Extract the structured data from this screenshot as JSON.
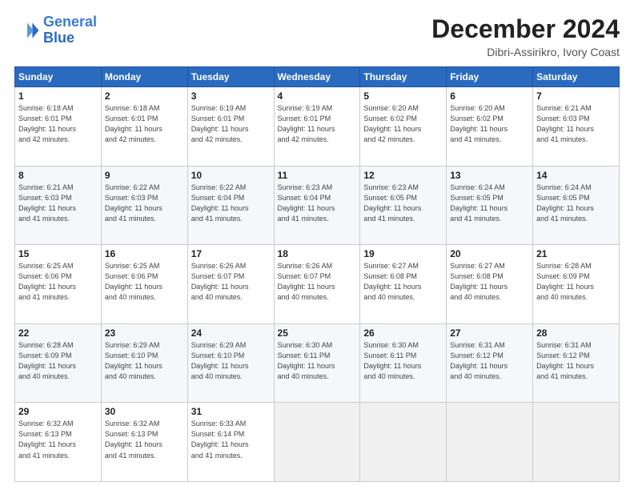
{
  "header": {
    "logo_line1": "General",
    "logo_line2": "Blue",
    "main_title": "December 2024",
    "subtitle": "Dibri-Assirikro, Ivory Coast"
  },
  "weekdays": [
    "Sunday",
    "Monday",
    "Tuesday",
    "Wednesday",
    "Thursday",
    "Friday",
    "Saturday"
  ],
  "weeks": [
    [
      {
        "day": "1",
        "info": "Sunrise: 6:18 AM\nSunset: 6:01 PM\nDaylight: 11 hours\nand 42 minutes."
      },
      {
        "day": "2",
        "info": "Sunrise: 6:18 AM\nSunset: 6:01 PM\nDaylight: 11 hours\nand 42 minutes."
      },
      {
        "day": "3",
        "info": "Sunrise: 6:19 AM\nSunset: 6:01 PM\nDaylight: 11 hours\nand 42 minutes."
      },
      {
        "day": "4",
        "info": "Sunrise: 6:19 AM\nSunset: 6:01 PM\nDaylight: 11 hours\nand 42 minutes."
      },
      {
        "day": "5",
        "info": "Sunrise: 6:20 AM\nSunset: 6:02 PM\nDaylight: 11 hours\nand 42 minutes."
      },
      {
        "day": "6",
        "info": "Sunrise: 6:20 AM\nSunset: 6:02 PM\nDaylight: 11 hours\nand 41 minutes."
      },
      {
        "day": "7",
        "info": "Sunrise: 6:21 AM\nSunset: 6:03 PM\nDaylight: 11 hours\nand 41 minutes."
      }
    ],
    [
      {
        "day": "8",
        "info": "Sunrise: 6:21 AM\nSunset: 6:03 PM\nDaylight: 11 hours\nand 41 minutes."
      },
      {
        "day": "9",
        "info": "Sunrise: 6:22 AM\nSunset: 6:03 PM\nDaylight: 11 hours\nand 41 minutes."
      },
      {
        "day": "10",
        "info": "Sunrise: 6:22 AM\nSunset: 6:04 PM\nDaylight: 11 hours\nand 41 minutes."
      },
      {
        "day": "11",
        "info": "Sunrise: 6:23 AM\nSunset: 6:04 PM\nDaylight: 11 hours\nand 41 minutes."
      },
      {
        "day": "12",
        "info": "Sunrise: 6:23 AM\nSunset: 6:05 PM\nDaylight: 11 hours\nand 41 minutes."
      },
      {
        "day": "13",
        "info": "Sunrise: 6:24 AM\nSunset: 6:05 PM\nDaylight: 11 hours\nand 41 minutes."
      },
      {
        "day": "14",
        "info": "Sunrise: 6:24 AM\nSunset: 6:05 PM\nDaylight: 11 hours\nand 41 minutes."
      }
    ],
    [
      {
        "day": "15",
        "info": "Sunrise: 6:25 AM\nSunset: 6:06 PM\nDaylight: 11 hours\nand 41 minutes."
      },
      {
        "day": "16",
        "info": "Sunrise: 6:25 AM\nSunset: 6:06 PM\nDaylight: 11 hours\nand 40 minutes."
      },
      {
        "day": "17",
        "info": "Sunrise: 6:26 AM\nSunset: 6:07 PM\nDaylight: 11 hours\nand 40 minutes."
      },
      {
        "day": "18",
        "info": "Sunrise: 6:26 AM\nSunset: 6:07 PM\nDaylight: 11 hours\nand 40 minutes."
      },
      {
        "day": "19",
        "info": "Sunrise: 6:27 AM\nSunset: 6:08 PM\nDaylight: 11 hours\nand 40 minutes."
      },
      {
        "day": "20",
        "info": "Sunrise: 6:27 AM\nSunset: 6:08 PM\nDaylight: 11 hours\nand 40 minutes."
      },
      {
        "day": "21",
        "info": "Sunrise: 6:28 AM\nSunset: 6:09 PM\nDaylight: 11 hours\nand 40 minutes."
      }
    ],
    [
      {
        "day": "22",
        "info": "Sunrise: 6:28 AM\nSunset: 6:09 PM\nDaylight: 11 hours\nand 40 minutes."
      },
      {
        "day": "23",
        "info": "Sunrise: 6:29 AM\nSunset: 6:10 PM\nDaylight: 11 hours\nand 40 minutes."
      },
      {
        "day": "24",
        "info": "Sunrise: 6:29 AM\nSunset: 6:10 PM\nDaylight: 11 hours\nand 40 minutes."
      },
      {
        "day": "25",
        "info": "Sunrise: 6:30 AM\nSunset: 6:11 PM\nDaylight: 11 hours\nand 40 minutes."
      },
      {
        "day": "26",
        "info": "Sunrise: 6:30 AM\nSunset: 6:11 PM\nDaylight: 11 hours\nand 40 minutes."
      },
      {
        "day": "27",
        "info": "Sunrise: 6:31 AM\nSunset: 6:12 PM\nDaylight: 11 hours\nand 40 minutes."
      },
      {
        "day": "28",
        "info": "Sunrise: 6:31 AM\nSunset: 6:12 PM\nDaylight: 11 hours\nand 41 minutes."
      }
    ],
    [
      {
        "day": "29",
        "info": "Sunrise: 6:32 AM\nSunset: 6:13 PM\nDaylight: 11 hours\nand 41 minutes."
      },
      {
        "day": "30",
        "info": "Sunrise: 6:32 AM\nSunset: 6:13 PM\nDaylight: 11 hours\nand 41 minutes."
      },
      {
        "day": "31",
        "info": "Sunrise: 6:33 AM\nSunset: 6:14 PM\nDaylight: 11 hours\nand 41 minutes."
      },
      {
        "day": "",
        "info": ""
      },
      {
        "day": "",
        "info": ""
      },
      {
        "day": "",
        "info": ""
      },
      {
        "day": "",
        "info": ""
      }
    ]
  ]
}
